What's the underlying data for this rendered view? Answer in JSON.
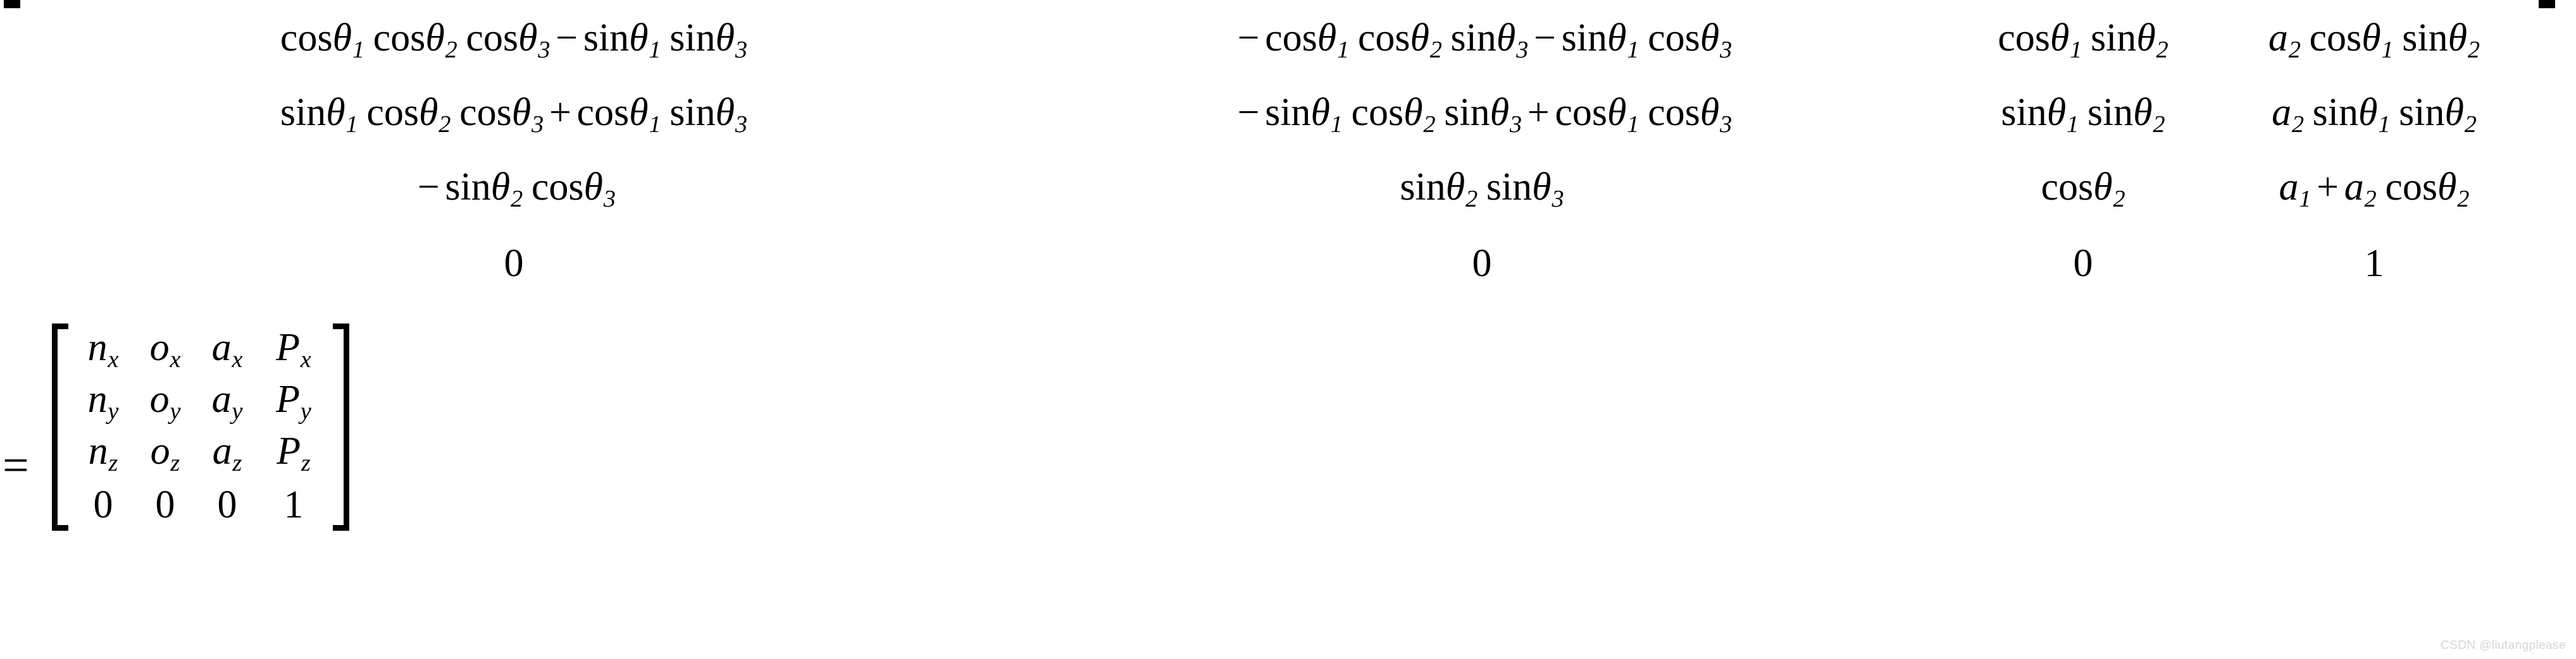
{
  "document": {
    "kind": "equation-image",
    "description": "Homogeneous transformation matrix of a 3-link manipulator equated to the n-o-a-P pose matrix"
  },
  "equals": {
    "symbol": "="
  },
  "matrix_a": {
    "name": "forward-kinematics-matrix",
    "rows": 4,
    "cols": 4,
    "left_bracket": "[",
    "right_bracket": "]",
    "cells": [
      [
        {
          "latex": "\\cos\\theta_1\\cos\\theta_2\\cos\\theta_3 - \\sin\\theta_1\\sin\\theta_3",
          "tokens": [
            {
              "t": "fn",
              "v": "cos"
            },
            {
              "t": "var",
              "v": "θ",
              "sub": "1"
            },
            {
              "t": "fn",
              "v": "cos",
              "sp": true
            },
            {
              "t": "var",
              "v": "θ",
              "sub": "2"
            },
            {
              "t": "fn",
              "v": "cos",
              "sp": true
            },
            {
              "t": "var",
              "v": "θ",
              "sub": "3"
            },
            {
              "t": "op",
              "v": "−"
            },
            {
              "t": "fn",
              "v": "sin"
            },
            {
              "t": "var",
              "v": "θ",
              "sub": "1"
            },
            {
              "t": "fn",
              "v": "sin",
              "sp": true
            },
            {
              "t": "var",
              "v": "θ",
              "sub": "3"
            }
          ]
        },
        {
          "latex": "-\\cos\\theta_1\\cos\\theta_2\\sin\\theta_3 - \\sin\\theta_1\\cos\\theta_3",
          "tokens": [
            {
              "t": "op",
              "v": "−"
            },
            {
              "t": "fn",
              "v": "cos"
            },
            {
              "t": "var",
              "v": "θ",
              "sub": "1"
            },
            {
              "t": "fn",
              "v": "cos",
              "sp": true
            },
            {
              "t": "var",
              "v": "θ",
              "sub": "2"
            },
            {
              "t": "fn",
              "v": "sin",
              "sp": true
            },
            {
              "t": "var",
              "v": "θ",
              "sub": "3"
            },
            {
              "t": "op",
              "v": "−"
            },
            {
              "t": "fn",
              "v": "sin"
            },
            {
              "t": "var",
              "v": "θ",
              "sub": "1"
            },
            {
              "t": "fn",
              "v": "cos",
              "sp": true
            },
            {
              "t": "var",
              "v": "θ",
              "sub": "3"
            }
          ]
        },
        {
          "latex": "\\cos\\theta_1\\sin\\theta_2",
          "tokens": [
            {
              "t": "fn",
              "v": "cos"
            },
            {
              "t": "var",
              "v": "θ",
              "sub": "1"
            },
            {
              "t": "fn",
              "v": "sin",
              "sp": true
            },
            {
              "t": "var",
              "v": "θ",
              "sub": "2"
            }
          ]
        },
        {
          "latex": "a_2\\cos\\theta_1\\sin\\theta_2",
          "tokens": [
            {
              "t": "var",
              "v": "a",
              "sub": "2"
            },
            {
              "t": "fn",
              "v": "cos",
              "sp": true
            },
            {
              "t": "var",
              "v": "θ",
              "sub": "1"
            },
            {
              "t": "fn",
              "v": "sin",
              "sp": true
            },
            {
              "t": "var",
              "v": "θ",
              "sub": "2"
            }
          ]
        }
      ],
      [
        {
          "latex": "\\sin\\theta_1\\cos\\theta_2\\cos\\theta_3 + \\cos\\theta_1\\sin\\theta_3",
          "tokens": [
            {
              "t": "fn",
              "v": "sin"
            },
            {
              "t": "var",
              "v": "θ",
              "sub": "1"
            },
            {
              "t": "fn",
              "v": "cos",
              "sp": true
            },
            {
              "t": "var",
              "v": "θ",
              "sub": "2"
            },
            {
              "t": "fn",
              "v": "cos",
              "sp": true
            },
            {
              "t": "var",
              "v": "θ",
              "sub": "3"
            },
            {
              "t": "op",
              "v": "+"
            },
            {
              "t": "fn",
              "v": "cos"
            },
            {
              "t": "var",
              "v": "θ",
              "sub": "1"
            },
            {
              "t": "fn",
              "v": "sin",
              "sp": true
            },
            {
              "t": "var",
              "v": "θ",
              "sub": "3"
            }
          ]
        },
        {
          "latex": "-\\sin\\theta_1\\cos\\theta_2\\sin\\theta_3 + \\cos\\theta_1\\cos\\theta_3",
          "tokens": [
            {
              "t": "op",
              "v": "−"
            },
            {
              "t": "fn",
              "v": "sin"
            },
            {
              "t": "var",
              "v": "θ",
              "sub": "1"
            },
            {
              "t": "fn",
              "v": "cos",
              "sp": true
            },
            {
              "t": "var",
              "v": "θ",
              "sub": "2"
            },
            {
              "t": "fn",
              "v": "sin",
              "sp": true
            },
            {
              "t": "var",
              "v": "θ",
              "sub": "3"
            },
            {
              "t": "op",
              "v": "+"
            },
            {
              "t": "fn",
              "v": "cos"
            },
            {
              "t": "var",
              "v": "θ",
              "sub": "1"
            },
            {
              "t": "fn",
              "v": "cos",
              "sp": true
            },
            {
              "t": "var",
              "v": "θ",
              "sub": "3"
            }
          ]
        },
        {
          "latex": "\\sin\\theta_1\\sin\\theta_2",
          "tokens": [
            {
              "t": "fn",
              "v": "sin"
            },
            {
              "t": "var",
              "v": "θ",
              "sub": "1"
            },
            {
              "t": "fn",
              "v": "sin",
              "sp": true
            },
            {
              "t": "var",
              "v": "θ",
              "sub": "2"
            }
          ]
        },
        {
          "latex": "a_2\\sin\\theta_1\\sin\\theta_2",
          "tokens": [
            {
              "t": "var",
              "v": "a",
              "sub": "2"
            },
            {
              "t": "fn",
              "v": "sin",
              "sp": true
            },
            {
              "t": "var",
              "v": "θ",
              "sub": "1"
            },
            {
              "t": "fn",
              "v": "sin",
              "sp": true
            },
            {
              "t": "var",
              "v": "θ",
              "sub": "2"
            }
          ]
        }
      ],
      [
        {
          "latex": "-\\sin\\theta_2\\cos\\theta_3",
          "tokens": [
            {
              "t": "op",
              "v": "−"
            },
            {
              "t": "fn",
              "v": "sin"
            },
            {
              "t": "var",
              "v": "θ",
              "sub": "2"
            },
            {
              "t": "fn",
              "v": "cos",
              "sp": true
            },
            {
              "t": "var",
              "v": "θ",
              "sub": "3"
            }
          ]
        },
        {
          "latex": "\\sin\\theta_2\\sin\\theta_3",
          "tokens": [
            {
              "t": "fn",
              "v": "sin"
            },
            {
              "t": "var",
              "v": "θ",
              "sub": "2"
            },
            {
              "t": "fn",
              "v": "sin",
              "sp": true
            },
            {
              "t": "var",
              "v": "θ",
              "sub": "3"
            }
          ]
        },
        {
          "latex": "\\cos\\theta_2",
          "tokens": [
            {
              "t": "fn",
              "v": "cos"
            },
            {
              "t": "var",
              "v": "θ",
              "sub": "2"
            }
          ]
        },
        {
          "latex": "a_1 + a_2\\cos\\theta_2",
          "tokens": [
            {
              "t": "var",
              "v": "a",
              "sub": "1"
            },
            {
              "t": "op",
              "v": "+"
            },
            {
              "t": "var",
              "v": "a",
              "sub": "2"
            },
            {
              "t": "fn",
              "v": "cos",
              "sp": true
            },
            {
              "t": "var",
              "v": "θ",
              "sub": "2"
            }
          ]
        }
      ],
      [
        {
          "latex": "0",
          "tokens": [
            {
              "t": "num",
              "v": "0"
            }
          ]
        },
        {
          "latex": "0",
          "tokens": [
            {
              "t": "num",
              "v": "0"
            }
          ]
        },
        {
          "latex": "0",
          "tokens": [
            {
              "t": "num",
              "v": "0"
            }
          ]
        },
        {
          "latex": "1",
          "tokens": [
            {
              "t": "num",
              "v": "1"
            }
          ]
        }
      ]
    ]
  },
  "matrix_b": {
    "name": "pose-matrix",
    "rows": 4,
    "cols": 4,
    "left_bracket": "[",
    "right_bracket": "]",
    "cells": [
      [
        {
          "latex": "n_x",
          "tokens": [
            {
              "t": "var",
              "v": "n",
              "sub": "x"
            }
          ]
        },
        {
          "latex": "o_x",
          "tokens": [
            {
              "t": "var",
              "v": "o",
              "sub": "x"
            }
          ]
        },
        {
          "latex": "a_x",
          "tokens": [
            {
              "t": "var",
              "v": "a",
              "sub": "x"
            }
          ]
        },
        {
          "latex": "P_x",
          "tokens": [
            {
              "t": "var",
              "v": "P",
              "sub": "x"
            }
          ]
        }
      ],
      [
        {
          "latex": "n_y",
          "tokens": [
            {
              "t": "var",
              "v": "n",
              "sub": "y"
            }
          ]
        },
        {
          "latex": "o_y",
          "tokens": [
            {
              "t": "var",
              "v": "o",
              "sub": "y"
            }
          ]
        },
        {
          "latex": "a_y",
          "tokens": [
            {
              "t": "var",
              "v": "a",
              "sub": "y"
            }
          ]
        },
        {
          "latex": "P_y",
          "tokens": [
            {
              "t": "var",
              "v": "P",
              "sub": "y"
            }
          ]
        }
      ],
      [
        {
          "latex": "n_z",
          "tokens": [
            {
              "t": "var",
              "v": "n",
              "sub": "z"
            }
          ]
        },
        {
          "latex": "o_z",
          "tokens": [
            {
              "t": "var",
              "v": "o",
              "sub": "z"
            }
          ]
        },
        {
          "latex": "a_z",
          "tokens": [
            {
              "t": "var",
              "v": "a",
              "sub": "z"
            }
          ]
        },
        {
          "latex": "P_z",
          "tokens": [
            {
              "t": "var",
              "v": "P",
              "sub": "z"
            }
          ]
        }
      ],
      [
        {
          "latex": "0",
          "tokens": [
            {
              "t": "num",
              "v": "0"
            }
          ]
        },
        {
          "latex": "0",
          "tokens": [
            {
              "t": "num",
              "v": "0"
            }
          ]
        },
        {
          "latex": "0",
          "tokens": [
            {
              "t": "num",
              "v": "0"
            }
          ]
        },
        {
          "latex": "1",
          "tokens": [
            {
              "t": "num",
              "v": "1"
            }
          ]
        }
      ]
    ]
  },
  "watermark": {
    "text": "CSDN @liutangplease",
    "color": "#d5d5d5"
  }
}
